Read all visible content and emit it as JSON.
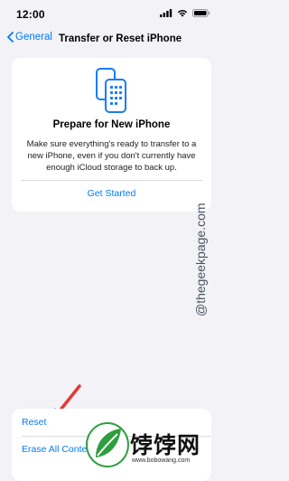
{
  "status_bar": {
    "time": "12:00"
  },
  "nav": {
    "back_label": "General",
    "title": "Transfer or Reset iPhone"
  },
  "card": {
    "title": "Prepare for New iPhone",
    "description": "Make sure everything's ready to transfer to a new iPhone, even if you don't currently have enough iCloud storage to back up.",
    "action_label": "Get Started"
  },
  "list": {
    "items": [
      {
        "label": "Reset"
      },
      {
        "label": "Erase All Conter"
      }
    ]
  },
  "overlays": {
    "watermark_text": "@thegeekpage.com",
    "logo_text": "饽饽网",
    "logo_url": "www.bobowang.com",
    "arrow_color": "#e53935"
  },
  "colors": {
    "accent": "#007aff",
    "background": "#f2f2f7",
    "card": "#ffffff"
  }
}
